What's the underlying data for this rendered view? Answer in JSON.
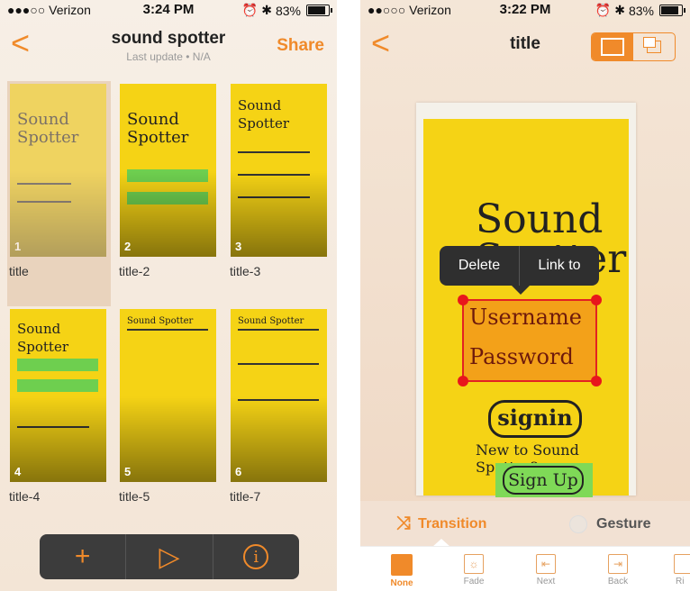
{
  "left": {
    "status": {
      "carrier": "●●●○○ Verizon",
      "time": "3:24 PM",
      "battery": "83%",
      "battery_level": 0.83
    },
    "nav": {
      "back": "<",
      "title": "sound spotter",
      "subtitle": "Last update • N/A",
      "share": "Share"
    },
    "screens": [
      {
        "label": "title",
        "num": "1",
        "sketch": "Sound Spotter",
        "selected": true
      },
      {
        "label": "title-2",
        "num": "2",
        "sketch": "Sound Spotter"
      },
      {
        "label": "title-3",
        "num": "3",
        "sketch": "Sound Spotter"
      },
      {
        "label": "title-4",
        "num": "4",
        "sketch": "Sound Spotter"
      },
      {
        "label": "title-5",
        "num": "5",
        "sketch": "Sound Spotter"
      },
      {
        "label": "title-7",
        "num": "6",
        "sketch": "Sound Spotter"
      }
    ],
    "toolbar": {
      "add": "+",
      "play": "▷",
      "info": "i"
    }
  },
  "right": {
    "status": {
      "carrier": "●●○○○ Verizon",
      "time": "3:22 PM",
      "battery": "83%",
      "battery_level": 0.83
    },
    "nav": {
      "back": "<",
      "title": "title"
    },
    "sketch": {
      "title": "Sound Spotter",
      "username": "Username",
      "password": "Password",
      "signin": "signin",
      "new_to": "New to Sound Spotter?",
      "signup": "Sign Up"
    },
    "popover": {
      "delete": "Delete",
      "link": "Link to"
    },
    "modes": {
      "transition": "Transition",
      "gesture": "Gesture"
    },
    "transitions": [
      {
        "label": "None",
        "active": true
      },
      {
        "label": "Fade"
      },
      {
        "label": "Next"
      },
      {
        "label": "Back"
      },
      {
        "label": "Ri"
      }
    ],
    "accent": "#f08a2a"
  }
}
